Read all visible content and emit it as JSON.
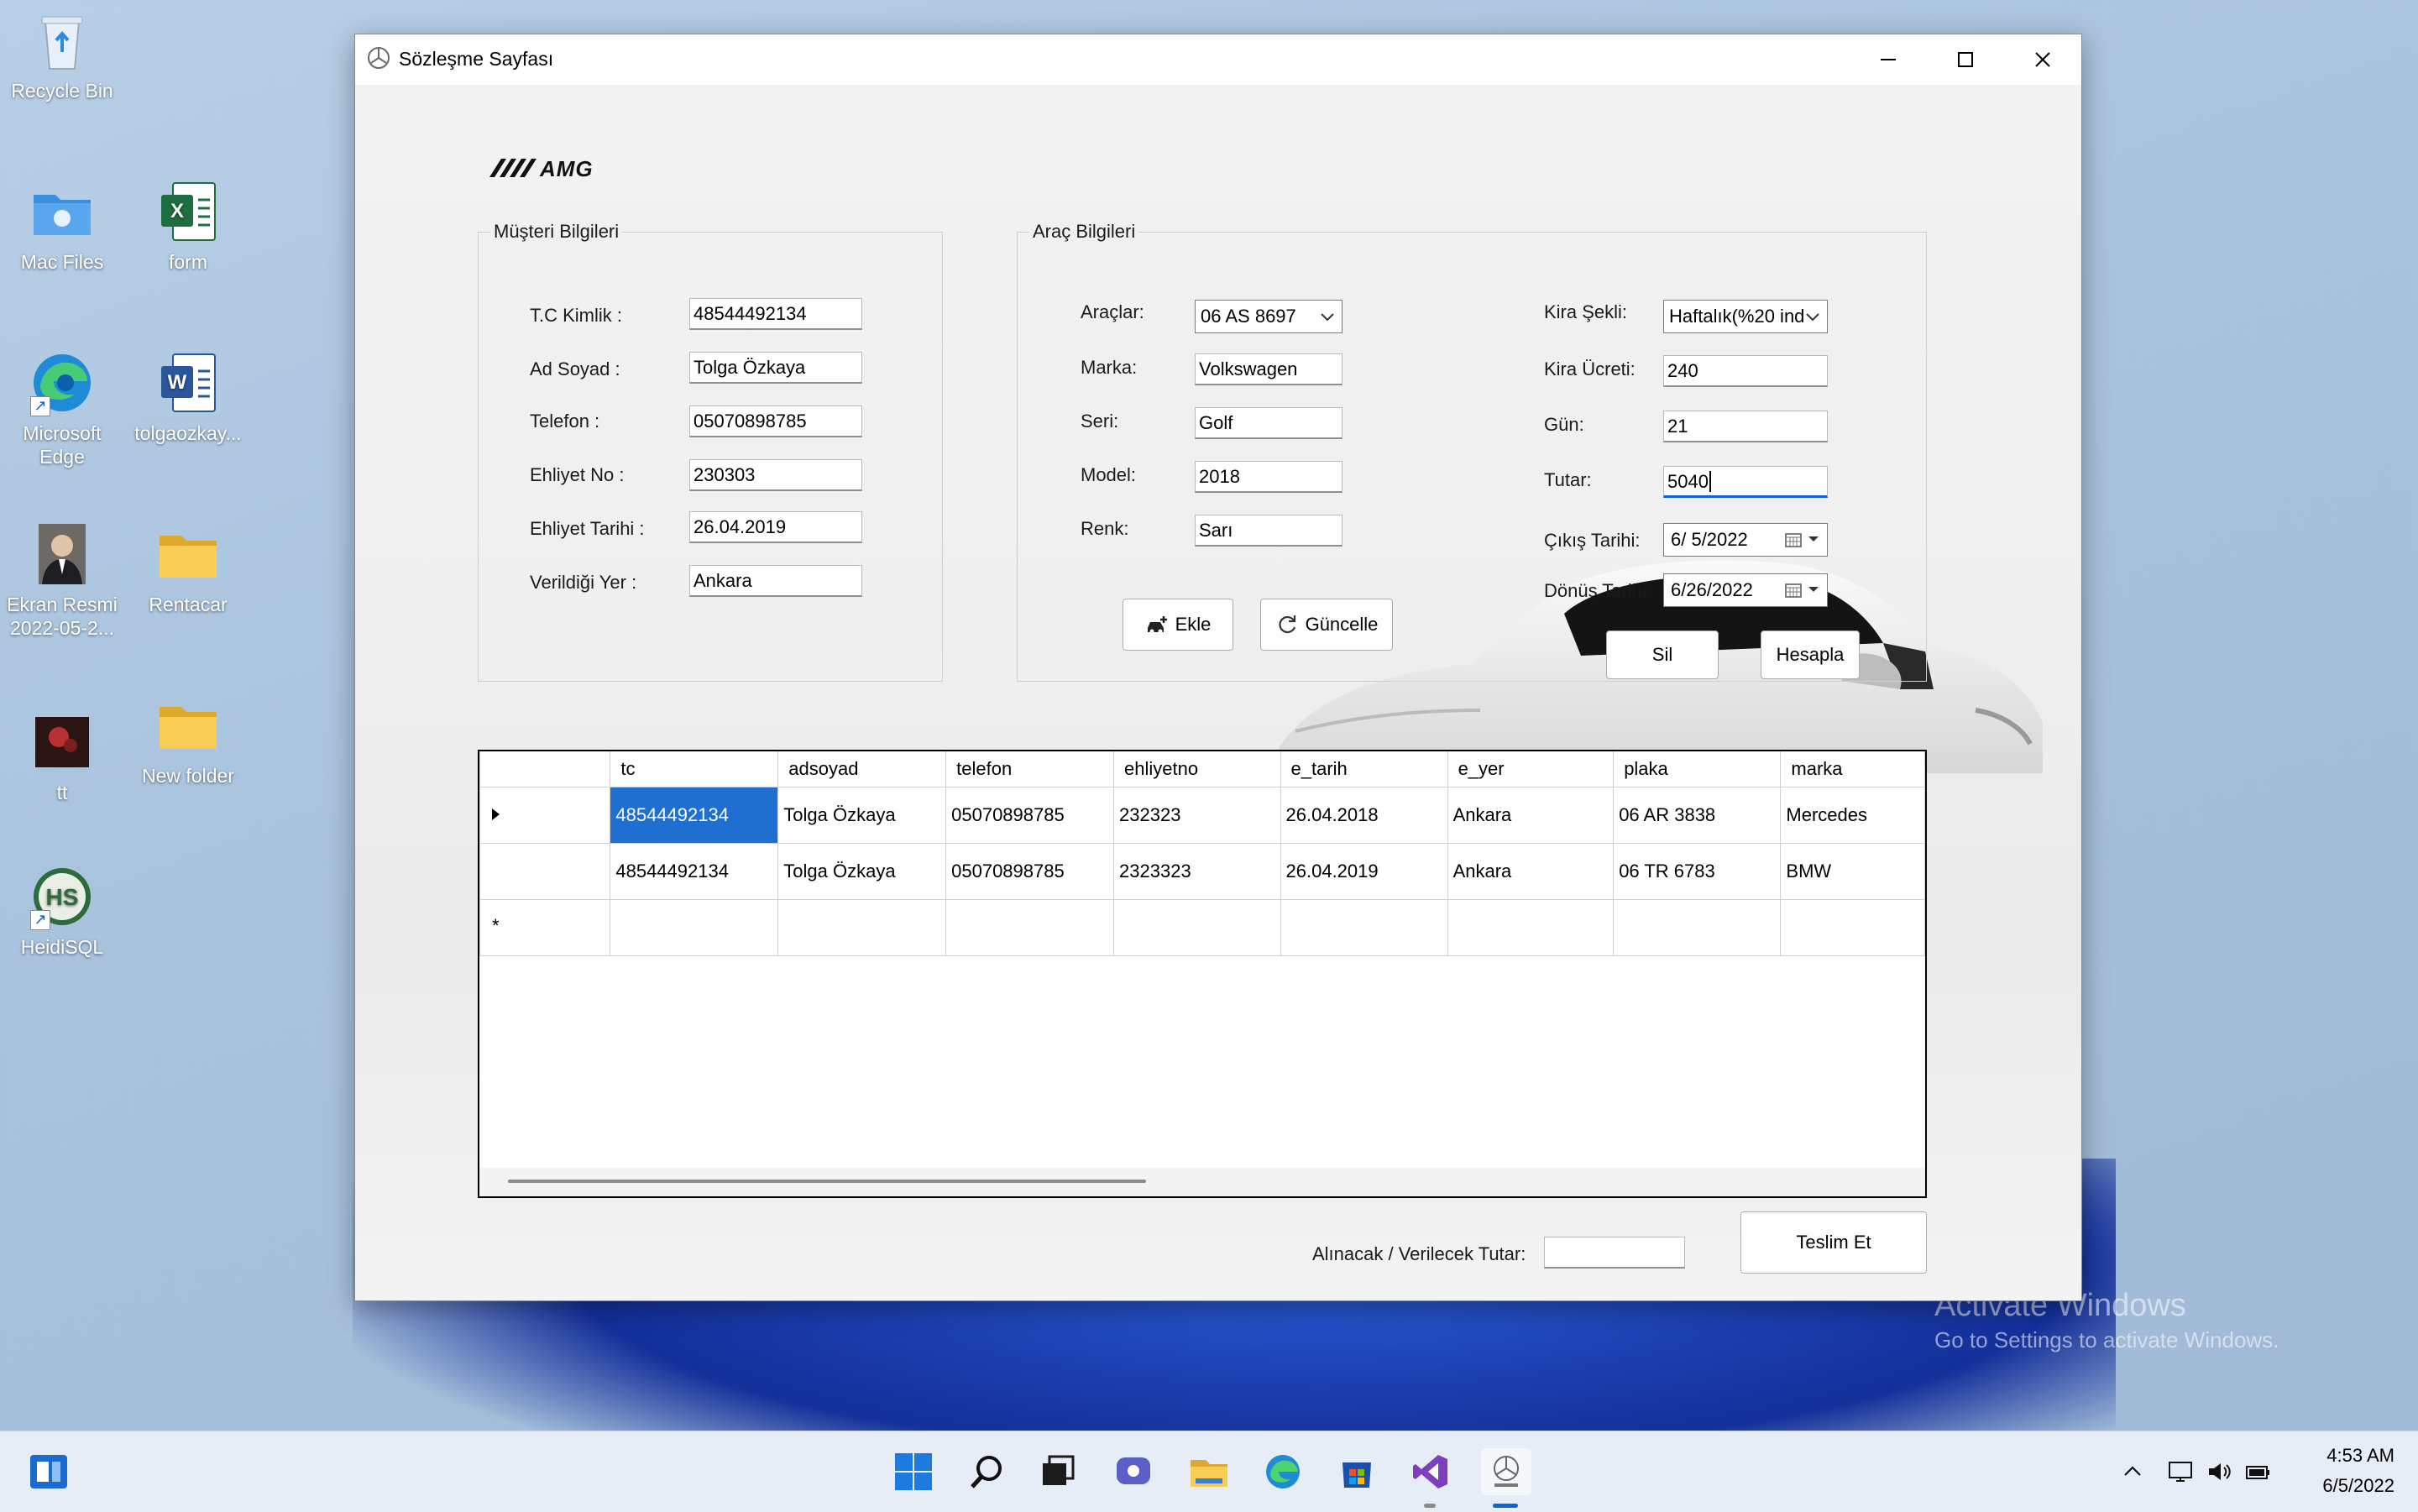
{
  "desktop": {
    "icons": [
      {
        "name": "recycle-bin",
        "label": "Recycle Bin"
      },
      {
        "name": "mac-files",
        "label": "Mac Files"
      },
      {
        "name": "form",
        "label": "form"
      },
      {
        "name": "microsoft-edge",
        "label": "Microsoft Edge"
      },
      {
        "name": "tolgaozkay",
        "label": "tolgaozkay..."
      },
      {
        "name": "ekran-resmi",
        "label": "Ekran Resmi 2022-05-2..."
      },
      {
        "name": "rentacar",
        "label": "Rentacar"
      },
      {
        "name": "tt",
        "label": "tt"
      },
      {
        "name": "new-folder",
        "label": "New folder"
      },
      {
        "name": "heidisql",
        "label": "HeidiSQL"
      }
    ],
    "watermark": {
      "line1": "Activate Windows",
      "line2": "Go to Settings to activate Windows."
    }
  },
  "window": {
    "title": "Sözleşme Sayfası",
    "logo": "AMG"
  },
  "customer": {
    "group_title": "Müşteri Bilgileri",
    "fields": [
      {
        "label": "T.C Kimlik :",
        "value": "48544492134"
      },
      {
        "label": "Ad Soyad :",
        "value": "Tolga Özkaya"
      },
      {
        "label": "Telefon :",
        "value": "05070898785"
      },
      {
        "label": "Ehliyet No :",
        "value": "230303"
      },
      {
        "label": "Ehliyet Tarihi :",
        "value": "26.04.2019"
      },
      {
        "label": "Verildiği Yer :",
        "value": "Ankara"
      }
    ]
  },
  "vehicle": {
    "group_title": "Araç Bilgileri",
    "araclar_label": "Araçlar:",
    "araclar_value": "06 AS 8697",
    "marka_label": "Marka:",
    "marka_value": "Volkswagen",
    "seri_label": "Seri:",
    "seri_value": "Golf",
    "model_label": "Model:",
    "model_value": "2018",
    "renk_label": "Renk:",
    "renk_value": "Sarı",
    "kira_sekli_label": "Kira Şekli:",
    "kira_sekli_value": "Haftalık(%20 ind",
    "kira_ucreti_label": "Kira Ücreti:",
    "kira_ucreti_value": "240",
    "gun_label": "Gün:",
    "gun_value": "21",
    "tutar_label": "Tutar:",
    "tutar_value": "5040",
    "cikis_label": "Çıkış Tarihi:",
    "cikis_value": "6/ 5/2022",
    "donus_label": "Dönüş Tarihi:",
    "donus_value": "6/26/2022"
  },
  "buttons": {
    "ekle": "Ekle",
    "guncelle": "Güncelle",
    "sil": "Sil",
    "hesapla": "Hesapla",
    "teslim": "Teslim Et"
  },
  "grid": {
    "columns": [
      "tc",
      "adsoyad",
      "telefon",
      "ehliyetno",
      "e_tarih",
      "e_yer",
      "plaka",
      "marka"
    ],
    "rows": [
      [
        "48544492134",
        "Tolga Özkaya",
        "05070898785",
        "232323",
        "26.04.2018",
        "Ankara",
        "06 AR 3838",
        "Mercedes"
      ],
      [
        "48544492134",
        "Tolga Özkaya",
        "05070898785",
        "2323323",
        "26.04.2019",
        "Ankara",
        "06 TR 6783",
        "BMW"
      ]
    ],
    "new_row_marker": "*"
  },
  "footer": {
    "tutar_label": "Alınacak / Verilecek Tutar:",
    "tutar_value": ""
  },
  "taskbar": {
    "time": "4:53 AM",
    "date": "6/5/2022"
  },
  "colors": {
    "selection": "#1f6fd1",
    "focus": "#0a64d6"
  }
}
